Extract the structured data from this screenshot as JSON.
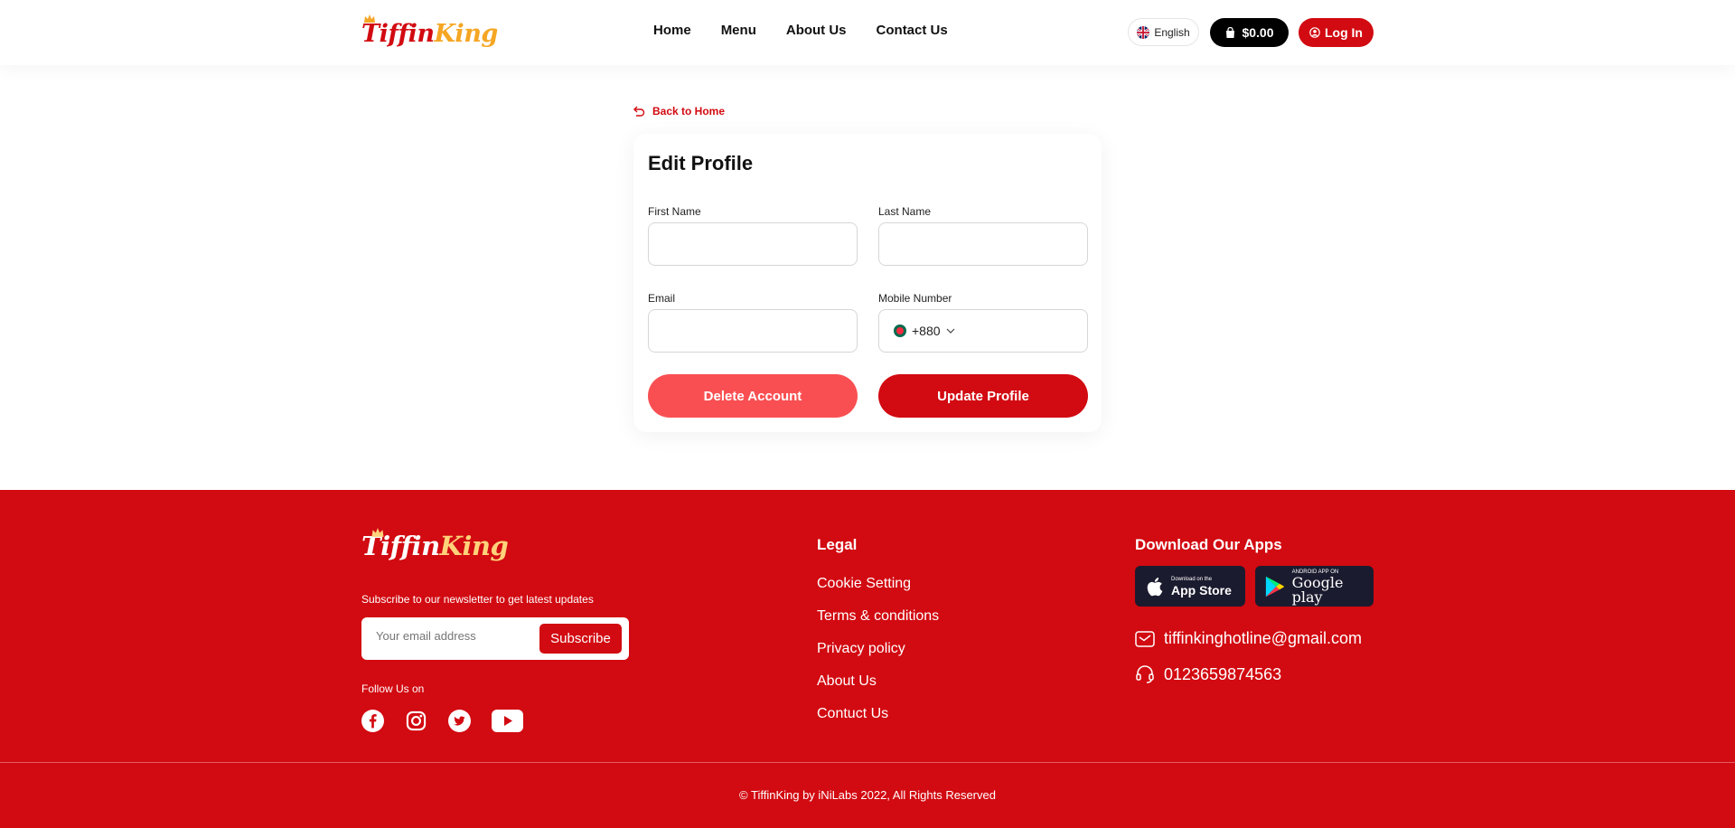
{
  "header": {
    "logo": "TiffinKing",
    "nav": [
      "Home",
      "Menu",
      "About Us",
      "Contact Us"
    ],
    "language": "English",
    "cart_total": "$0.00",
    "login_label": "Log In"
  },
  "back_link": "Back to Home",
  "form": {
    "title": "Edit Profile",
    "first_name_label": "First Name",
    "first_name_value": "",
    "last_name_label": "Last Name",
    "last_name_value": "",
    "email_label": "Email",
    "email_value": "",
    "mobile_label": "Mobile Number",
    "country_code": "+880",
    "delete_label": "Delete Account",
    "update_label": "Update Profile"
  },
  "footer": {
    "logo": "TiffinKing",
    "newsletter_text": "Subscribe to our newsletter to get latest updates",
    "email_placeholder": "Your email address",
    "subscribe_label": "Subscribe",
    "follow_text": "Follow Us on",
    "legal_title": "Legal",
    "legal_links": [
      "Cookie Setting",
      "Terms & conditions",
      "Privacy policy",
      "About Us",
      "Contuct Us"
    ],
    "apps_title": "Download Our Apps",
    "app_store_small": "Download on the",
    "app_store_big": "App Store",
    "google_play_small": "ANDROID APP ON",
    "google_play_big": "Google play",
    "email": "tiffinkinghotline@gmail.com",
    "phone": "0123659874563",
    "copyright": "© TiffinKing by iNiLabs 2022, All Rights Reserved"
  },
  "colors": {
    "brand_red": "#d20a11",
    "delete_red": "#f94f52",
    "logo_orange": "#f5a623"
  }
}
